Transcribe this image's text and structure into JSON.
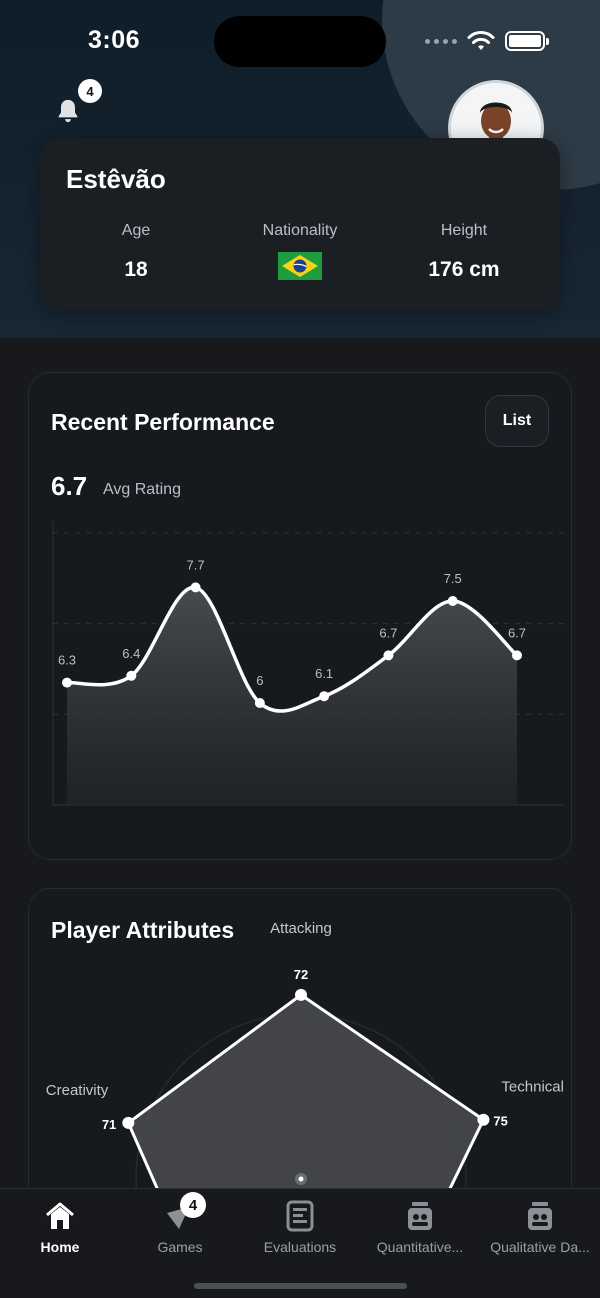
{
  "status_bar": {
    "time": "3:06"
  },
  "header": {
    "notification_count": "4"
  },
  "profile": {
    "name": "Estêvão",
    "stats": [
      {
        "label": "Age",
        "value": "18"
      },
      {
        "label": "Nationality",
        "value": ""
      },
      {
        "label": "Height",
        "value": "176 cm"
      }
    ]
  },
  "performance": {
    "title": "Recent Performance",
    "list_button": "List",
    "avg_value": "6.7",
    "avg_label": "Avg Rating"
  },
  "attributes": {
    "title": "Player Attributes"
  },
  "chart_data": [
    {
      "type": "area",
      "title": "Recent Performance",
      "x": [
        1,
        2,
        3,
        4,
        5,
        6,
        7,
        8
      ],
      "values": [
        6.3,
        6.4,
        7.7,
        6,
        6.1,
        6.7,
        7.5,
        6.7
      ],
      "data_labels": [
        "6.3",
        "6.4",
        "7.7",
        "6",
        "6.1",
        "6.7",
        "7.5",
        "6.7"
      ],
      "ylim": [
        4.5,
        8.5
      ],
      "grid": true,
      "colors": {
        "line": "#ffffff",
        "fill": "#3a3d42"
      }
    },
    {
      "type": "radar",
      "title": "Player Attributes",
      "axes": [
        "Attacking",
        "Technical",
        "",
        "",
        "Creativity"
      ],
      "values": [
        72,
        75,
        null,
        null,
        71
      ],
      "value_labels": [
        "72",
        "75",
        "",
        "",
        "71"
      ],
      "max": 100
    }
  ],
  "tabbar": {
    "tabs": [
      {
        "label": "Home",
        "icon": "home-icon",
        "active": true
      },
      {
        "label": "Games",
        "icon": "games-icon",
        "badge": "4"
      },
      {
        "label": "Evaluations",
        "icon": "evaluations-icon"
      },
      {
        "label": "Quantitative...",
        "icon": "quantitative-icon"
      },
      {
        "label": "Qualitative Da...",
        "icon": "qualitative-icon"
      }
    ]
  },
  "colors": {
    "accent_online": "#22c55e",
    "background": "#17191c",
    "card": "#1b1f24"
  }
}
